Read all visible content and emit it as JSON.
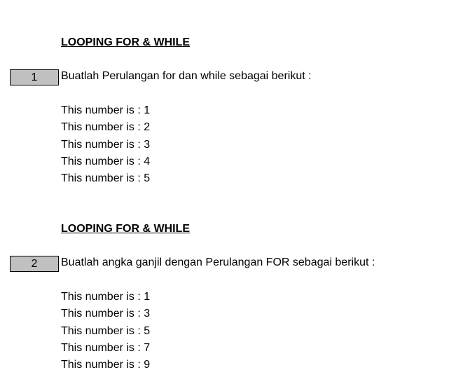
{
  "sections": [
    {
      "title": "LOOPING FOR & WHILE",
      "number": "1",
      "instruction": "Buatlah Perulangan for dan while sebagai berikut :",
      "lines": [
        "This number is : 1",
        "This number is : 2",
        "This number is : 3",
        "This number is : 4",
        "This number is : 5"
      ]
    },
    {
      "title": "LOOPING FOR & WHILE",
      "number": "2",
      "instruction": "Buatlah angka ganjil dengan Perulangan FOR sebagai berikut :",
      "lines": [
        "This number is : 1",
        "This number is : 3",
        "This number is : 5",
        "This number is : 7",
        "This number is : 9"
      ]
    }
  ],
  "colors": {
    "number_box_fill": "#c0c0c0",
    "text": "#000000"
  }
}
